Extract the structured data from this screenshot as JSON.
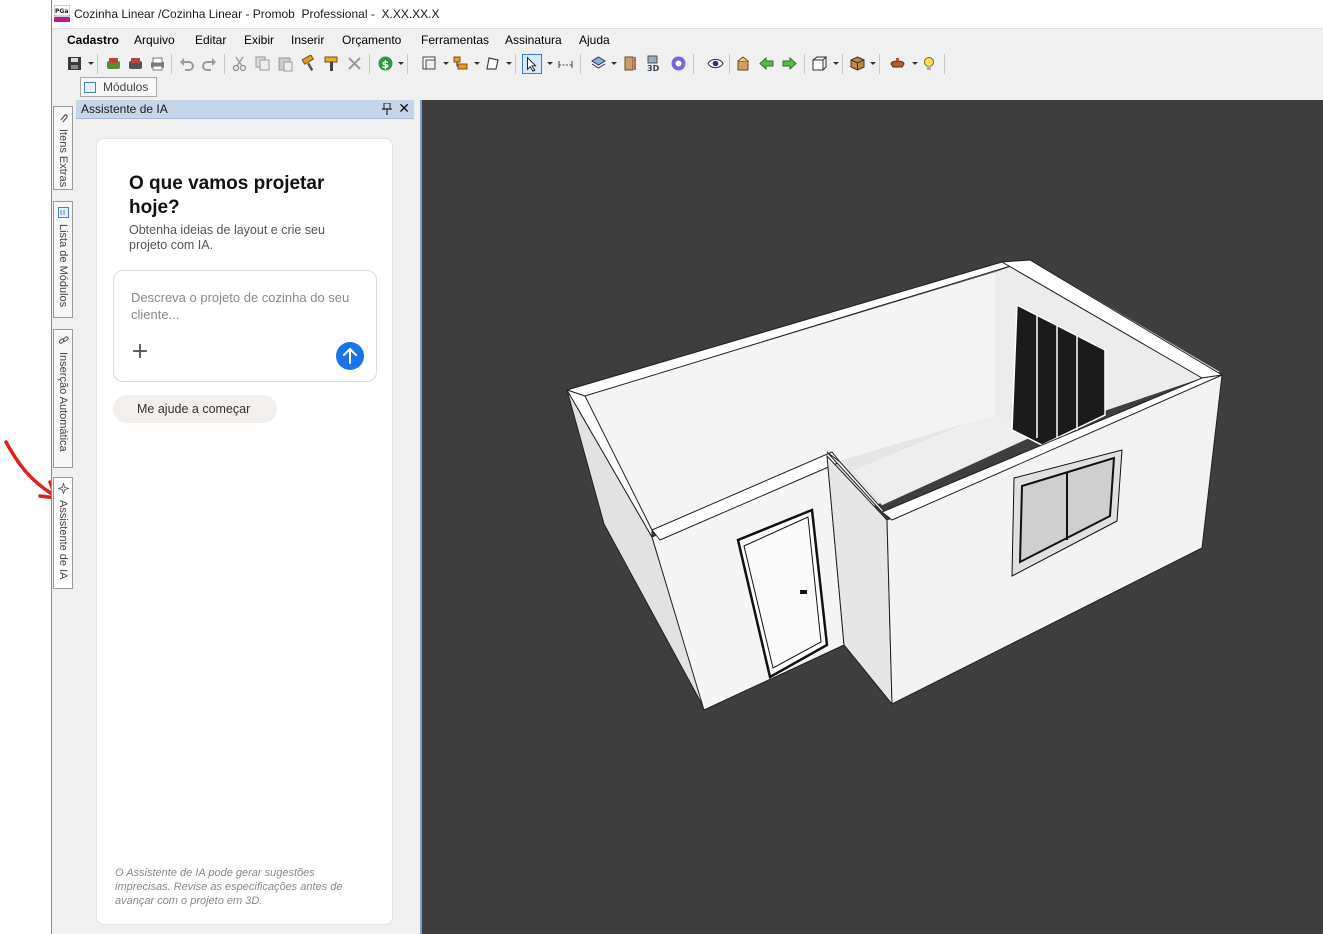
{
  "window": {
    "title": "Cozinha Linear /Cozinha Linear - Promob  Professional -  X.XX.XX.X"
  },
  "menu": [
    "Cadastro",
    "Arquivo",
    "Editar",
    "Exibir",
    "Inserir",
    "Orçamento",
    "Ferramentas",
    "Assinatura",
    "Ajuda"
  ],
  "tabs": {
    "modulos": "Módulos"
  },
  "side_tabs": [
    "Itens Extras",
    "Lista de Módulos",
    "Inserção Automática",
    "Assistente de IA"
  ],
  "panel": {
    "title": "Assistente de IA",
    "heading": "O que vamos projetar hoje?",
    "subheading": "Obtenha ideias de layout e crie seu projeto com IA.",
    "prompt_placeholder": "Descreva o projeto de cozinha do seu cliente...",
    "chip_label": "Me ajude a começar",
    "disclaimer": "O Assistente de IA pode gerar sugestões imprecisas. Revise as especificações antes de avançar com o projeto em 3D."
  },
  "icons": [
    "app-logo-icon",
    "save-icon",
    "print-icon",
    "undo-icon",
    "redo-icon",
    "cut-icon",
    "copy-icon",
    "paste-icon",
    "paint-icon",
    "delete-icon",
    "budget-icon",
    "select-icon",
    "layers-icon",
    "3d-icon",
    "eye-icon",
    "arrow-left-icon",
    "arrow-right-icon",
    "box-icon",
    "lamp-icon",
    "pin-icon",
    "close-icon",
    "plus-icon",
    "send-arrow-icon"
  ],
  "colors": {
    "panel_header": "#c5d6ea",
    "send_button": "#1a73e8",
    "viewport_bg": "#3e3e3e",
    "annotation_arrow": "#e02020"
  }
}
